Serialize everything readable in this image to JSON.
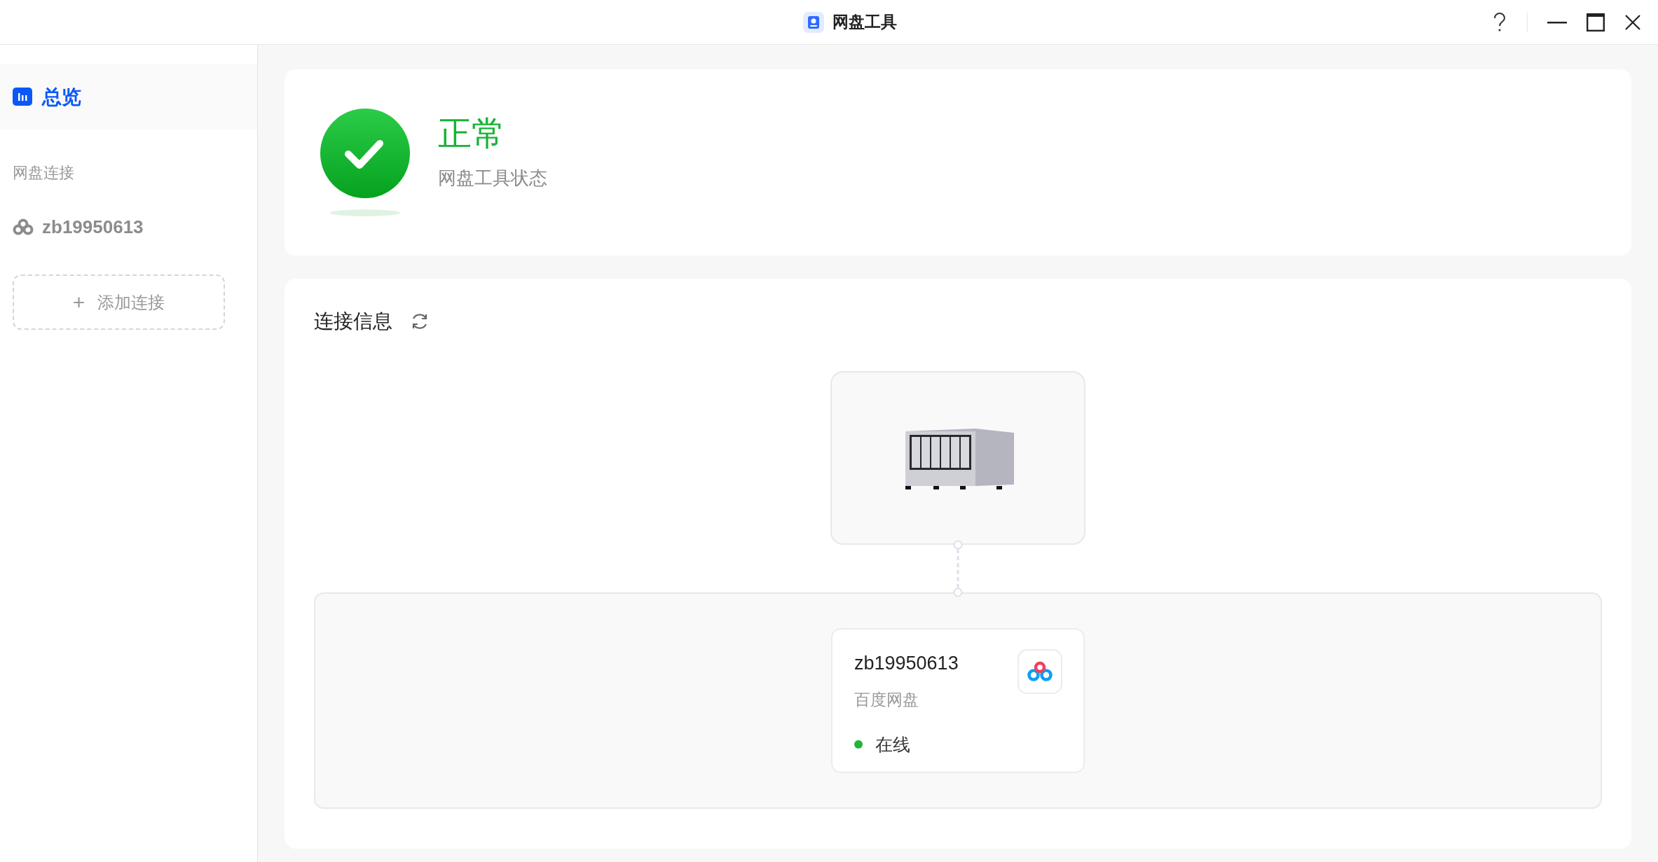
{
  "window": {
    "title": "网盘工具"
  },
  "sidebar": {
    "items": [
      {
        "kind": "nav",
        "label": "总览",
        "selected": true
      },
      {
        "kind": "section",
        "label": "网盘连接"
      },
      {
        "kind": "account",
        "label": "zb19950613",
        "selected": false
      }
    ],
    "add_button": {
      "icon": "+",
      "label": "添加连接"
    }
  },
  "status_card": {
    "healthy": true,
    "title": "正常",
    "subtitle": "网盘工具状态"
  },
  "connection_info": {
    "title": "连接信息",
    "connections": [
      {
        "name": "zb19950613",
        "provider": "百度网盘",
        "status": "在线",
        "online": true
      }
    ]
  }
}
